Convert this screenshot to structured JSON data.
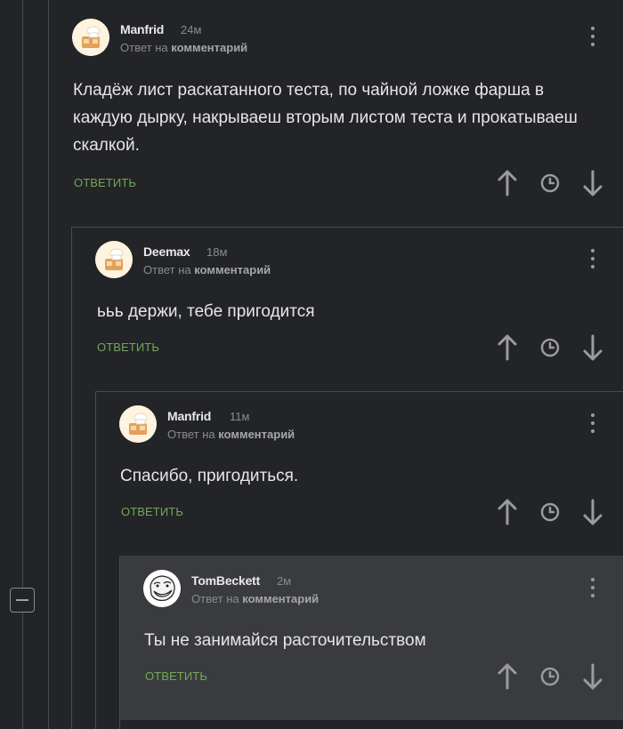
{
  "comments": [
    {
      "author": "Manfrid",
      "time": "24м",
      "reply_prefix": "Ответ на",
      "reply_target": "комментарий",
      "text": "Кладёж лист раскатанного теста, по чайной ложке фарша в\nкаждую дырку, накрываеш вторым листом теста и прокатываеш\nскалкой.",
      "reply_label": "Ответить",
      "avatar": "cook-hat-avatar"
    },
    {
      "author": "Deemax",
      "time": "18м",
      "reply_prefix": "Ответ на",
      "reply_target": "комментарий",
      "text": "ььь держи, тебе пригодится",
      "reply_label": "Ответить",
      "avatar": "cook-hat-avatar"
    },
    {
      "author": "Manfrid",
      "time": "11м",
      "reply_prefix": "Ответ на",
      "reply_target": "комментарий",
      "text": "Спасибо, пригодиться.",
      "reply_label": "Ответить",
      "avatar": "cook-hat-avatar"
    },
    {
      "author": "TomBeckett",
      "time": "2м",
      "reply_prefix": "Ответ на",
      "reply_target": "комментарий",
      "text": "Ты не занимайся расточительством",
      "reply_label": "Ответить",
      "avatar": "troll-face-avatar"
    }
  ],
  "icons": {
    "upvote": "arrow-up-icon",
    "save": "clock-icon",
    "downvote": "arrow-down-icon",
    "menu": "kebab-menu-icon",
    "collapse": "minus-square-icon"
  },
  "colors": {
    "background": "#232427",
    "highlight": "#3a3b3e",
    "reply_green": "#72a85a",
    "muted": "#8a8b8e"
  }
}
